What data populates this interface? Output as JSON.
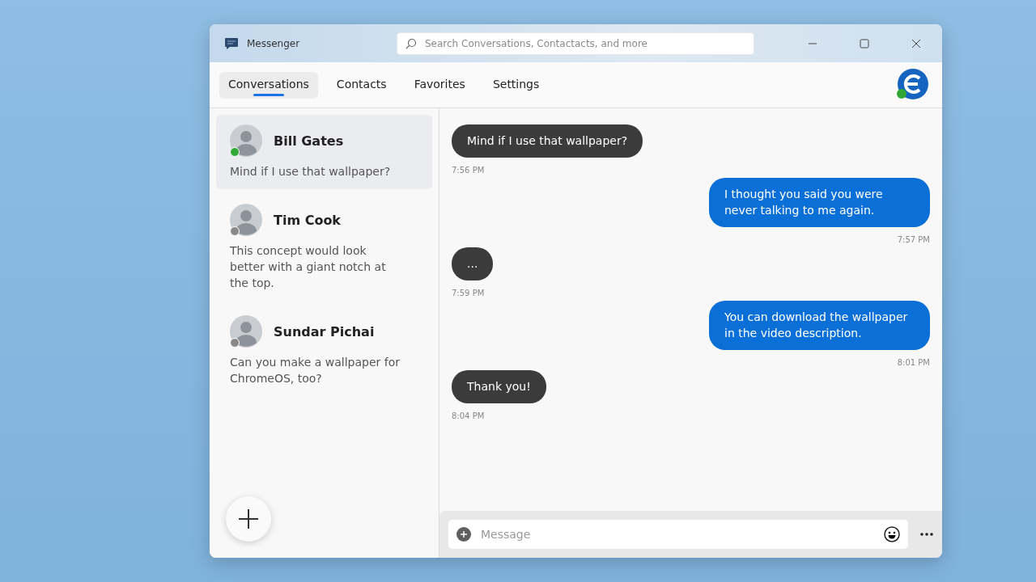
{
  "window": {
    "title": "Messenger"
  },
  "search": {
    "placeholder": "Search Conversations, Contactacts, and more"
  },
  "tabs": [
    {
      "label": "Conversations",
      "selected": true
    },
    {
      "label": "Contacts",
      "selected": false
    },
    {
      "label": "Favorites",
      "selected": false
    },
    {
      "label": "Settings",
      "selected": false
    }
  ],
  "account": {
    "online": true
  },
  "conversations": [
    {
      "name": "Bill Gates",
      "preview": "Mind if I use that wallpaper?",
      "online": true,
      "selected": true
    },
    {
      "name": "Tim Cook",
      "preview": "This concept would look better with a giant notch at the top.",
      "online": false,
      "selected": false
    },
    {
      "name": "Sundar Pichai",
      "preview": "Can you make a wallpaper for ChromeOS, too?",
      "online": false,
      "selected": false
    }
  ],
  "messages": [
    {
      "kind": "incoming",
      "text": "Mind if I use that wallpaper?",
      "time": "7:56 PM"
    },
    {
      "kind": "outgoing",
      "text": "I thought you said you were never talking to me again.",
      "time": "7:57 PM"
    },
    {
      "kind": "incoming",
      "text": "...",
      "time": "7:59 PM"
    },
    {
      "kind": "outgoing",
      "text": "You can download the wallpaper in the video description.",
      "time": "8:01 PM"
    },
    {
      "kind": "incoming",
      "text": "Thank you!",
      "time": "8:04 PM"
    }
  ],
  "composer": {
    "placeholder": "Message"
  }
}
